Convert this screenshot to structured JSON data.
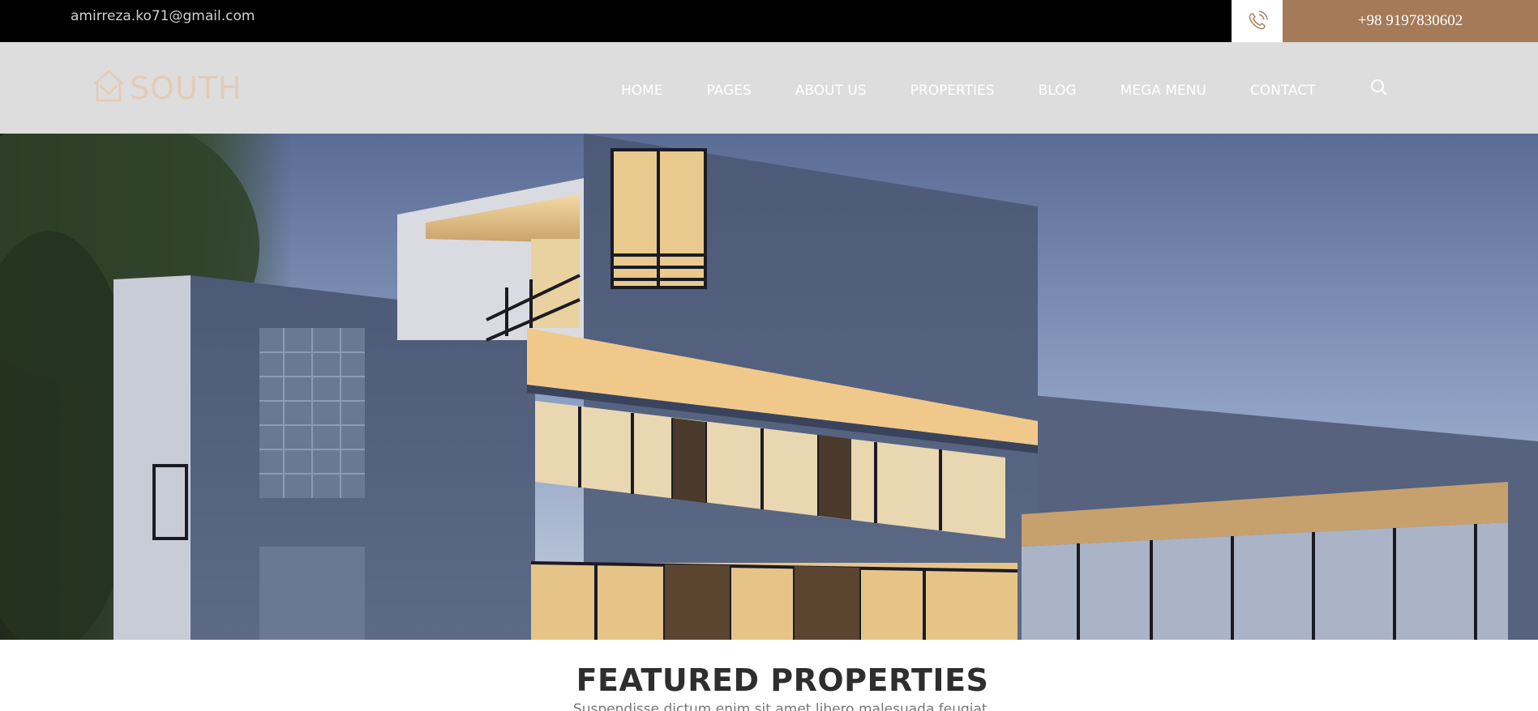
{
  "topbar": {
    "email": "amirreza.ko71@gmail.com",
    "phone": "+98 9197830602",
    "phone_icon": "phone-icon",
    "accent_color": "#a47a58"
  },
  "header": {
    "logo_text": "SOUTH",
    "logo_icon": "house-icon",
    "nav": [
      "HOME",
      "PAGES",
      "ABOUT US",
      "PROPERTIES",
      "BLOG",
      "MEGA MENU",
      "CONTACT"
    ],
    "search_icon": "search-icon"
  },
  "hero": {
    "image": "modern-house-dusk"
  },
  "featured": {
    "title": "FEATURED PROPERTIES",
    "subtitle": "Suspendisse dictum enim sit amet libero malesuada feugiat."
  }
}
